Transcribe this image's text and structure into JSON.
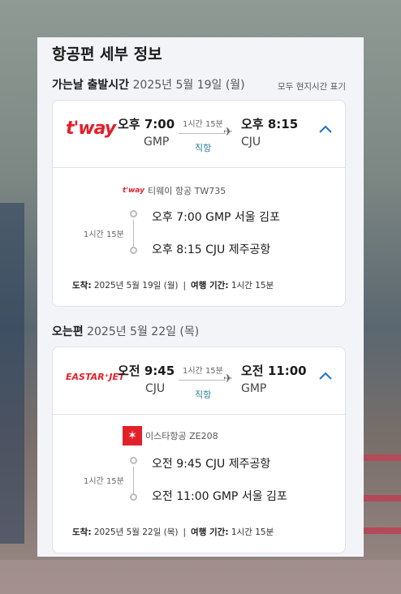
{
  "panel_title": "항공편 세부 정보",
  "local_time_label": "모두 현지시간 표기",
  "outbound": {
    "section_label": "가는날 출발시간",
    "section_date": "2025년 5월 19일 (월)",
    "logo_text": "t'way",
    "dep_time": "오후 7:00",
    "dep_code": "GMP",
    "arr_time": "오후 8:15",
    "arr_code": "CJU",
    "duration": "1시간 15분",
    "direct": "직항",
    "airline_logo_mini": "t'way",
    "airline_name": "티웨이 항공 TW735",
    "seg_duration": "1시간 15분",
    "stop1": "오후 7:00 GMP 서울 김포",
    "stop2": "오후 8:15 CJU 제주공항",
    "arrival_label": "도착:",
    "arrival_date": "2025년 5월 19일 (월)",
    "trip_label": "여행 기간:",
    "trip_duration": "1시간 15분"
  },
  "inbound": {
    "section_label": "오는편",
    "section_date": "2025년 5월 22일 (목)",
    "logo_text": "EASTAR⁺JET",
    "dep_time": "오전 9:45",
    "dep_code": "CJU",
    "arr_time": "오전 11:00",
    "arr_code": "GMP",
    "duration": "1시간 15분",
    "direct": "직항",
    "airline_name": "이스타항공 ZE208",
    "seg_duration": "1시간 15분",
    "stop1": "오전 9:45 CJU 제주공항",
    "stop2": "오전 11:00 GMP 서울 김포",
    "arrival_label": "도착:",
    "arrival_date": "2025년 5월 22일 (목)",
    "trip_label": "여행 기간:",
    "trip_duration": "1시간 15분"
  },
  "colors": {
    "brand_red": "#e2202a",
    "accent_blue": "#1a73c8",
    "direct_teal": "#2a7d8f"
  }
}
